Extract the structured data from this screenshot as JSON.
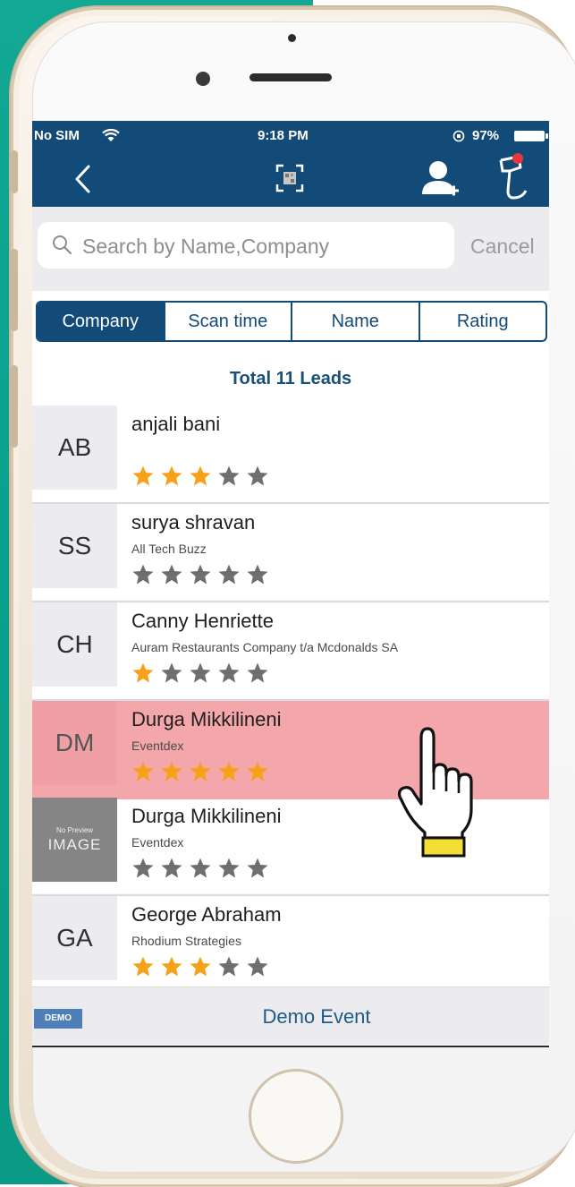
{
  "status_bar": {
    "carrier": "No SIM",
    "time": "9:18 PM",
    "battery": "97%"
  },
  "nav": {
    "back_icon": "chevron-left-icon",
    "qr_icon": "qr-scan-icon",
    "add_user_icon": "add-user-icon",
    "scanner_icon": "barcode-scanner-icon"
  },
  "search": {
    "placeholder": "Search by Name,Company",
    "cancel_label": "Cancel"
  },
  "sort_tabs": [
    {
      "label": "Company",
      "active": true
    },
    {
      "label": "Scan time",
      "active": false
    },
    {
      "label": "Name",
      "active": false
    },
    {
      "label": "Rating",
      "active": false
    }
  ],
  "total_label": "Total 11 Leads",
  "leads": [
    {
      "initials": "AB",
      "name": "anjali bani",
      "company": "",
      "rating": 3,
      "highlighted": false
    },
    {
      "initials": "SS",
      "name": "surya shravan",
      "company": "All Tech Buzz",
      "rating": 0,
      "highlighted": false
    },
    {
      "initials": "CH",
      "name": "Canny Henriette",
      "company": "Auram Restaurants Company t/a Mcdonalds SA",
      "rating": 1,
      "highlighted": false
    },
    {
      "initials": "DM",
      "name": "Durga Mikkilineni",
      "company": "Eventdex",
      "rating": 5,
      "highlighted": true
    },
    {
      "initials": "",
      "image_placeholder_small": "No Preview",
      "image_placeholder_big": "IMAGE",
      "name": "Durga Mikkilineni",
      "company": "Eventdex",
      "rating": 0,
      "highlighted": false
    },
    {
      "initials": "GA",
      "name": "George Abraham",
      "company": "Rhodium Strategies",
      "rating": 3,
      "highlighted": false
    }
  ],
  "footer": {
    "badge": "DEMO",
    "event_name": "Demo Event"
  },
  "colors": {
    "nav_bg": "#124a78",
    "star_on": "#f6a11a",
    "star_off": "#6e6e6e",
    "highlight": "#f4a7aa"
  }
}
